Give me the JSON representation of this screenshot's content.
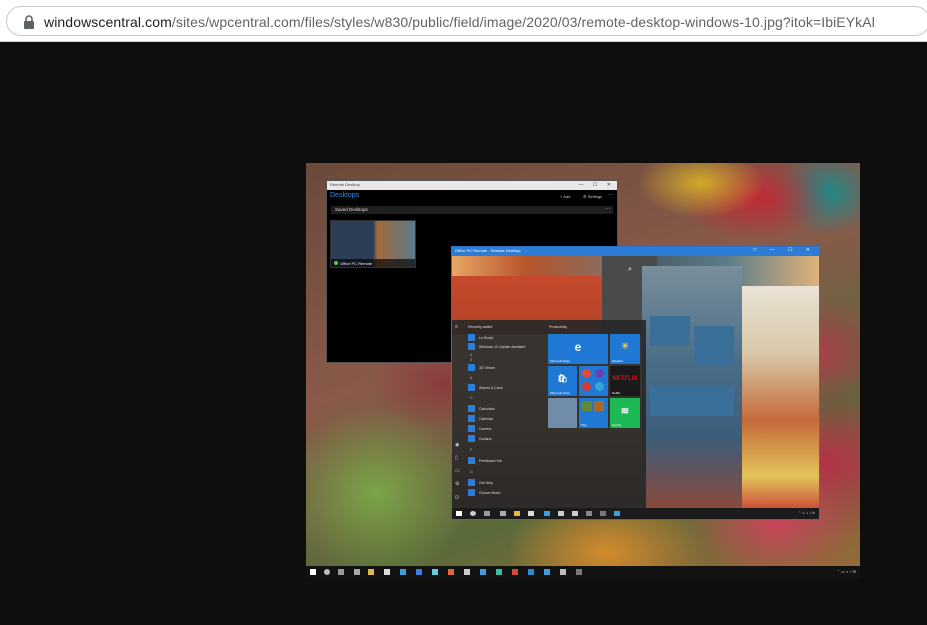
{
  "browser": {
    "url_host": "windowscentral.com",
    "url_path": "/sites/wpcentral.com/files/styles/w830/public/field/image/2020/03/remote-desktop-windows-10.jpg?itok=IbiEYkAl",
    "lock_icon": "lock-icon"
  },
  "remote_desktop_app": {
    "title": "Remote Desktop",
    "controls": "— ☐ ✕",
    "header": "Desktops",
    "add_label": "+ Add",
    "settings_label": "⚙ Settings",
    "more": "···",
    "group_label": "Saved Desktops",
    "connection_name": "Office PC Remote"
  },
  "session_window": {
    "title": "Office PC Remote - Remote Desktop",
    "controls": "□ — ☐ ✕",
    "start_menu": {
      "recently_added": "Recently added",
      "productivity": "Productivity",
      "apps": [
        {
          "label": "Lo Smart"
        },
        {
          "label": "Windows 10 Update Assistant"
        },
        {
          "label": "3D Viewer"
        },
        {
          "label": "Alarms & Clock"
        },
        {
          "label": "Calculator"
        },
        {
          "label": "Calendar"
        },
        {
          "label": "Camera"
        },
        {
          "label": "Cortana"
        },
        {
          "label": "Feedback Hub"
        },
        {
          "label": "Get Help"
        },
        {
          "label": "Groove Music"
        }
      ],
      "letters": [
        "#",
        "3",
        "A",
        "C",
        "F",
        "G"
      ],
      "tiles": [
        {
          "label": "Microsoft Edge",
          "glyph": "e",
          "color": "#1e78d4"
        },
        {
          "label": "Weather",
          "glyph": "☀",
          "color": "#1e78d4"
        },
        {
          "label": "Microsoft Store",
          "glyph": "🛍",
          "color": "#1e78d4"
        },
        {
          "label": "",
          "glyph": "",
          "color": "#1e78d4"
        },
        {
          "label": "Netflix",
          "glyph": "NETFLIX",
          "color": "#1a1a1a"
        },
        {
          "label": "",
          "glyph": "",
          "color": "#6f8ca8"
        },
        {
          "label": "Play",
          "glyph": "",
          "color": "#1e78d4"
        },
        {
          "label": "Spotify",
          "glyph": "≋",
          "color": "#1db954"
        }
      ]
    }
  }
}
